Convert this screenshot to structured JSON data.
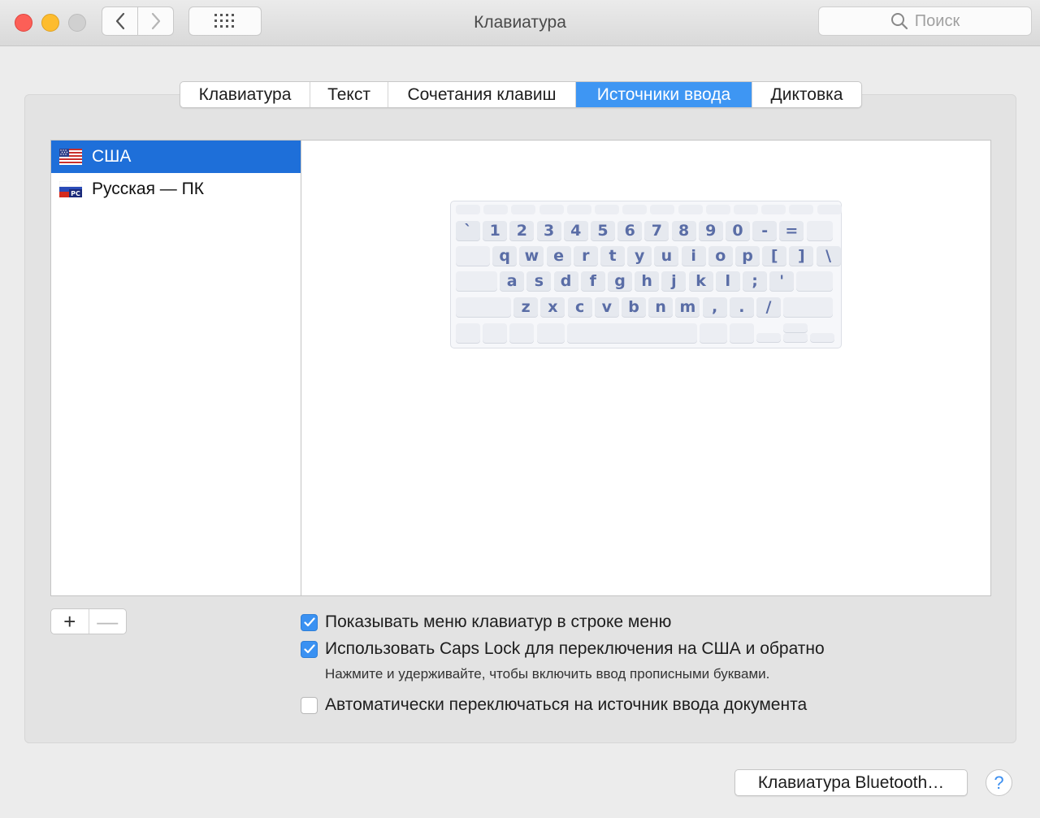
{
  "window": {
    "title": "Клавиатура",
    "search_placeholder": "Поиск"
  },
  "tabs": [
    {
      "label": "Клавиатура"
    },
    {
      "label": "Текст"
    },
    {
      "label": "Сочетания клавиш"
    },
    {
      "label": "Источники ввода"
    },
    {
      "label": "Диктовка"
    }
  ],
  "active_tab": "Источники ввода",
  "input_sources": [
    {
      "label": "США",
      "flag": "us-flag-icon",
      "selected": true
    },
    {
      "label": "Русская — ПК",
      "flag": "ru-pc-flag-icon",
      "selected": false
    }
  ],
  "keyboard": {
    "row1": [
      "`",
      "1",
      "2",
      "3",
      "4",
      "5",
      "6",
      "7",
      "8",
      "9",
      "0",
      "-",
      "="
    ],
    "row2": [
      "q",
      "w",
      "e",
      "r",
      "t",
      "y",
      "u",
      "i",
      "o",
      "p",
      "[",
      "]",
      "\\"
    ],
    "row3": [
      "a",
      "s",
      "d",
      "f",
      "g",
      "h",
      "j",
      "k",
      "l",
      ";",
      "'"
    ],
    "row4": [
      "z",
      "x",
      "c",
      "v",
      "b",
      "n",
      "m",
      ",",
      ".",
      "/"
    ]
  },
  "list_buttons": {
    "add": "+",
    "remove": "—"
  },
  "options": {
    "show_menu": {
      "label": "Показывать меню клавиатур в строке меню",
      "checked": true
    },
    "caps_lock": {
      "label": "Использовать Caps Lock для переключения на США и обратно",
      "checked": true
    },
    "caps_hint": "Нажмите и удерживайте, чтобы включить ввод прописными буквами.",
    "auto_switch": {
      "label": "Автоматически переключаться на источник ввода документа",
      "checked": false
    }
  },
  "bluetooth_button": "Клавиатура Bluetooth…",
  "help_button": "?",
  "colors": {
    "accent": "#3e96f3",
    "selection": "#1e6fd9",
    "key_text": "#5a6da6"
  }
}
